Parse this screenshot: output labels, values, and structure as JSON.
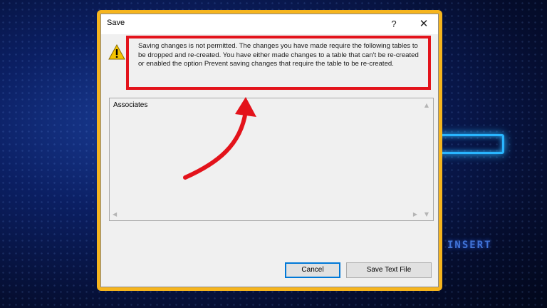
{
  "dialog": {
    "title": "Save",
    "help_label": "?",
    "close_label": "✕",
    "message": "Saving changes is not permitted. The changes you have made require the following tables to be dropped and re-created. You have either made changes to a table that can't be re-created or enabled the option Prevent saving changes that require the table to be re-created.",
    "warning_icon": "warning-icon",
    "list_items": [
      "Associates"
    ],
    "buttons": {
      "cancel": "Cancel",
      "save_text_file": "Save Text File"
    }
  },
  "background": {
    "glow_texts": [
      "INSERT"
    ]
  },
  "colors": {
    "frame": "#f6b51e",
    "highlight": "#e3131b",
    "focus": "#0078d7"
  }
}
